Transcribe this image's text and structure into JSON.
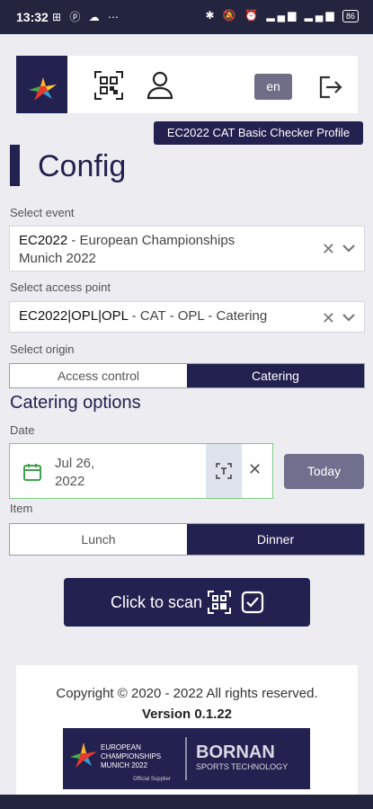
{
  "status_bar": {
    "time": "13:32",
    "notifications": "⊞ ⓟ ☁ ⋯",
    "system_icons": "✱ 🔕 ⏰ ▂▄▆ ▂▄▆",
    "battery": "86"
  },
  "header": {
    "language": "en",
    "profile": "EC2022 CAT Basic Checker Profile"
  },
  "page": {
    "title": "Config"
  },
  "event": {
    "label": "Select event",
    "code": "EC2022",
    "name": " - European Championships",
    "name_line2": "Munich 2022"
  },
  "access_point": {
    "label": "Select access point",
    "code": "EC2022|OPL|OPL",
    "name": " - CAT - OPL - Catering"
  },
  "origin": {
    "label": "Select origin",
    "options": [
      "Access control",
      "Catering"
    ],
    "selected": "Catering"
  },
  "catering": {
    "title": "Catering options",
    "date_label": "Date",
    "date_line1": "Jul 26,",
    "date_line2": "2022",
    "today_label": "Today",
    "item_label": "Item",
    "items": [
      "Lunch",
      "Dinner"
    ],
    "selected_item": "Dinner"
  },
  "scan": {
    "label": "Click to scan"
  },
  "footer": {
    "copyright": "Copyright © 2020 - 2022 All rights reserved.",
    "version": "Version 0.1.22",
    "sponsor_left": "EUROPEAN CHAMPIONSHIPS MUNICH 2022",
    "sponsor_right": "BORNAN",
    "sponsor_right_sub": "SPORTS TECHNOLOGY",
    "sponsor_tag": "Official Supplier"
  },
  "colors": {
    "primary": "#23214f",
    "button_gray": "#706f8d",
    "success_border": "#7fc98a",
    "background": "#ececf1"
  },
  "icons": [
    "qr-code-icon",
    "user-icon",
    "logout-icon",
    "calendar-icon",
    "scan-frame-icon",
    "clear-icon",
    "chevron-down-icon",
    "check-square-icon"
  ]
}
